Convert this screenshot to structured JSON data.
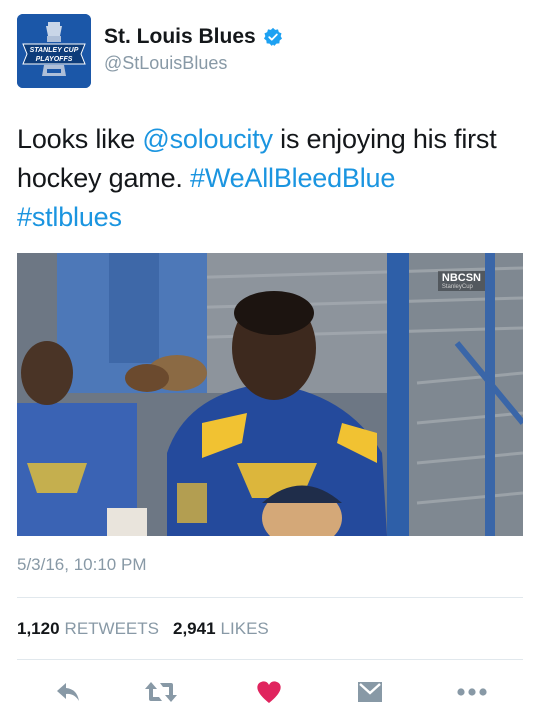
{
  "tweet": {
    "author_name": "St. Louis Blues",
    "author_handle": "@StLouisBlues",
    "avatar_text": "STANLEY CUP PLAYOFFS",
    "text_part1": "Looks like ",
    "mention": "@soloucity",
    "text_part2": " is enjoying his first hockey game. ",
    "hashtag1": "#WeAllBleedBlue",
    "hashtag2": "#stlblues",
    "media": {
      "description": "Broadcast still of fans in St. Louis Blues jerseys at a hockey game",
      "network_logo": "NBCSN",
      "network_sub": "StanleyCup"
    },
    "timestamp": "5/3/16, 10:10 PM",
    "retweets_count": "1,120",
    "retweets_label": "RETWEETS",
    "likes_count": "2,941",
    "likes_label": "LIKES"
  },
  "icons": [
    "verified-badge-icon",
    "reply-icon",
    "retweet-icon",
    "like-heart-icon",
    "direct-message-icon",
    "more-icon"
  ],
  "colors": {
    "link": "#1b95e0",
    "secondary_text": "#8899a6",
    "heart": "#e0245e",
    "action_icon": "#8899a6",
    "divider": "#e1e8ed"
  }
}
